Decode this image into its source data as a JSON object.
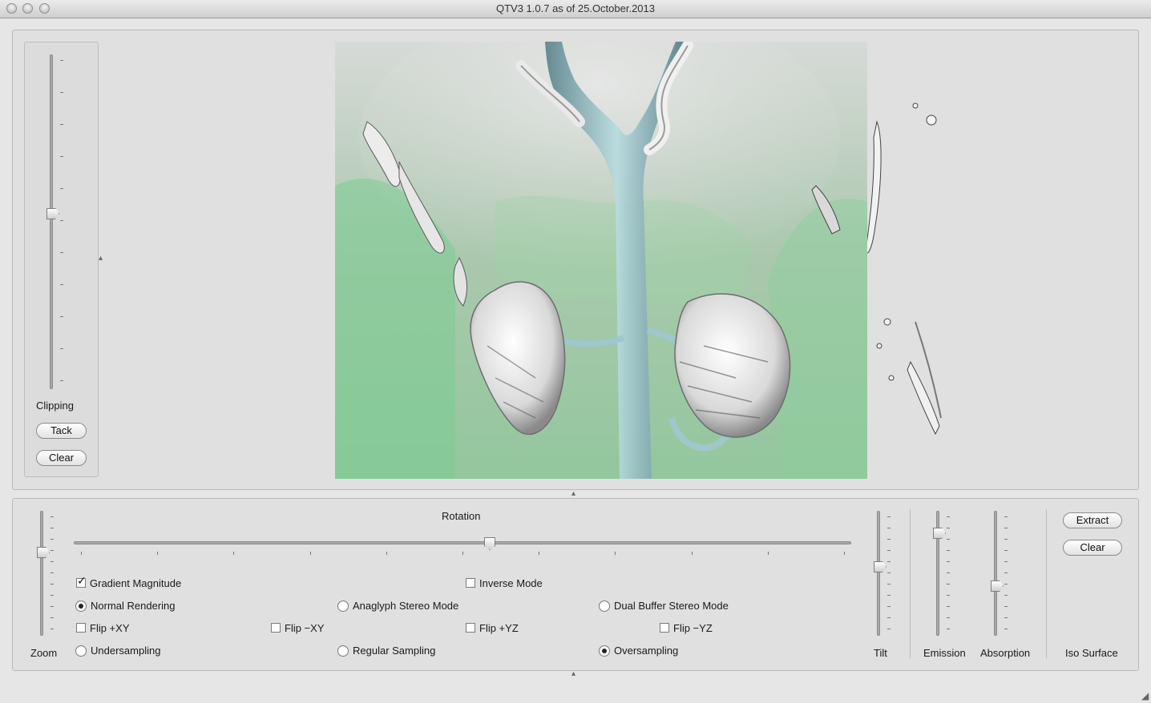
{
  "window": {
    "title": "QTV3 1.0.7 as of 25.October.2013"
  },
  "clipping": {
    "label": "Clipping",
    "tack_label": "Tack",
    "clear_label": "Clear",
    "slider_value_fraction": 0.52
  },
  "controls": {
    "zoom_label": "Zoom",
    "rotation_label": "Rotation",
    "tilt_label": "Tilt",
    "emission_label": "Emission",
    "absorption_label": "Absorption",
    "iso_surface_label": "Iso Surface",
    "extract_label": "Extract",
    "iso_clear_label": "Clear",
    "zoom_fraction": 0.68,
    "rotation_fraction": 0.535,
    "tilt_fraction": 0.55,
    "emission_fraction": 0.85,
    "absorption_fraction": 0.38
  },
  "options": {
    "gradient_magnitude": {
      "label": "Gradient Magnitude",
      "checked": true
    },
    "inverse_mode": {
      "label": "Inverse Mode",
      "checked": false
    },
    "rendering_modes": [
      {
        "label": "Normal Rendering",
        "selected": true
      },
      {
        "label": "Anaglyph Stereo Mode",
        "selected": false
      },
      {
        "label": "Dual Buffer Stereo Mode",
        "selected": false
      }
    ],
    "flips": [
      {
        "label": "Flip +XY",
        "checked": false
      },
      {
        "label": "Flip −XY",
        "checked": false
      },
      {
        "label": "Flip +YZ",
        "checked": false
      },
      {
        "label": "Flip −YZ",
        "checked": false
      }
    ],
    "sampling": [
      {
        "label": "Undersampling",
        "selected": false
      },
      {
        "label": "Regular Sampling",
        "selected": false
      },
      {
        "label": "Oversampling",
        "selected": true
      }
    ]
  },
  "colors": {
    "tissue_green": "#6fc58a",
    "vessel_blue": "#8fb9c0",
    "background": "#e0e0e0"
  }
}
